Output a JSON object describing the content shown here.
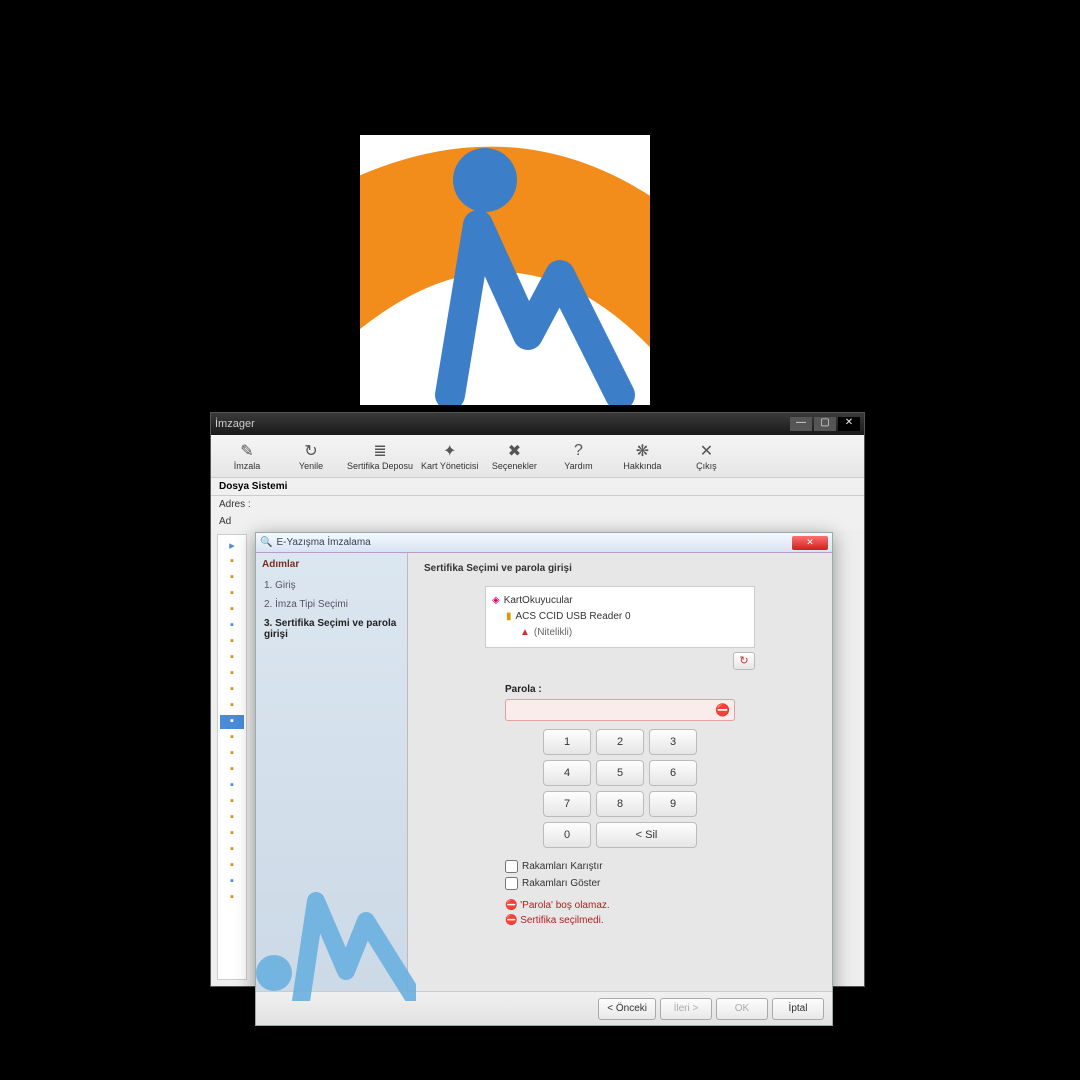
{
  "logo": {
    "name": "app-logo"
  },
  "window": {
    "title": "İmzager",
    "toolbar": [
      {
        "label": "İmzala",
        "icon": "✎"
      },
      {
        "label": "Yenile",
        "icon": "↻"
      },
      {
        "label": "Sertifika Deposu",
        "icon": "≣"
      },
      {
        "label": "Kart Yöneticisi",
        "icon": "✦"
      },
      {
        "label": "Seçenekler",
        "icon": "✖"
      },
      {
        "label": "Yardım",
        "icon": "?"
      },
      {
        "label": "Hakkında",
        "icon": "❋"
      },
      {
        "label": "Çıkış",
        "icon": "✕"
      }
    ],
    "subbar_label": "Dosya Sistemi",
    "addr_label": "Adres :",
    "column_ad": "Ad"
  },
  "dialog": {
    "title": "E-Yazışma İmzalama",
    "steps_header": "Adımlar",
    "steps": [
      "1. Giriş",
      "2. İmza Tipi Seçimi",
      "3. Sertifika Seçimi ve parola girişi"
    ],
    "active_step": 2,
    "content": {
      "section_title": "Sertifika Seçimi ve parola girişi",
      "tree": {
        "root": "KartOkuyucular",
        "reader": "ACS CCID USB Reader 0",
        "cert_suffix": "(Nitelikli)"
      },
      "parola_label": "Parola :",
      "keypad": [
        "1",
        "2",
        "3",
        "4",
        "5",
        "6",
        "7",
        "8",
        "9",
        "0",
        "< Sil"
      ],
      "checks": {
        "mix": "Rakamları Karıştır",
        "show": "Rakamları Göster"
      },
      "errors": [
        "'Parola' boş olamaz.",
        "Sertifika seçilmedi."
      ]
    },
    "footer": {
      "prev": "< Önceki",
      "next": "İleri >",
      "ok": "OK",
      "cancel": "İptal"
    }
  }
}
